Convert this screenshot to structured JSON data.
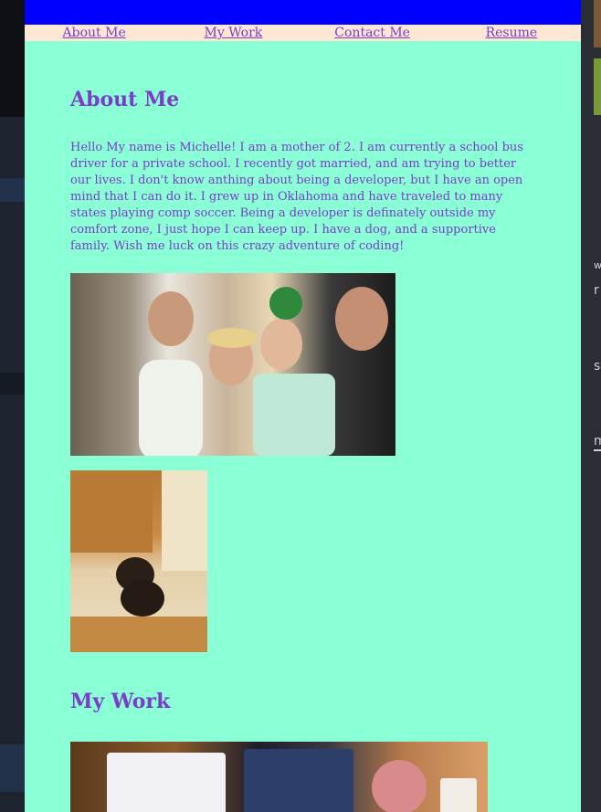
{
  "nav": {
    "about_label": "About Me",
    "work_label": "My Work",
    "contact_label": "Contact Me",
    "resume_label": "Resume"
  },
  "about": {
    "heading": "About Me",
    "bio": "Hello My name is Michelle! I am a mother of 2. I am currently a school bus driver for a private school. I recently got married, and am trying to better our lives. I don't know anthing about being a developer, but I have an open mind that I can do it. I grew up in Oklahoma and have traveled to many states playing comp soccer. Being a developer is definately outside my comfort zone, I just hope I can keep up. I have a dog, and a supportive family. Wish me luck on this crazy adventure of coding!"
  },
  "work": {
    "heading": "My Work"
  },
  "background": {
    "glyph_w": "w",
    "glyph_r": "r",
    "glyph_s": "s",
    "glyph_m": "m"
  },
  "colors": {
    "page_bg": "#8affd6",
    "top_bar": "#0000ff",
    "nav_bg": "#fde8d6",
    "accent_text": "#7b3cc8"
  }
}
